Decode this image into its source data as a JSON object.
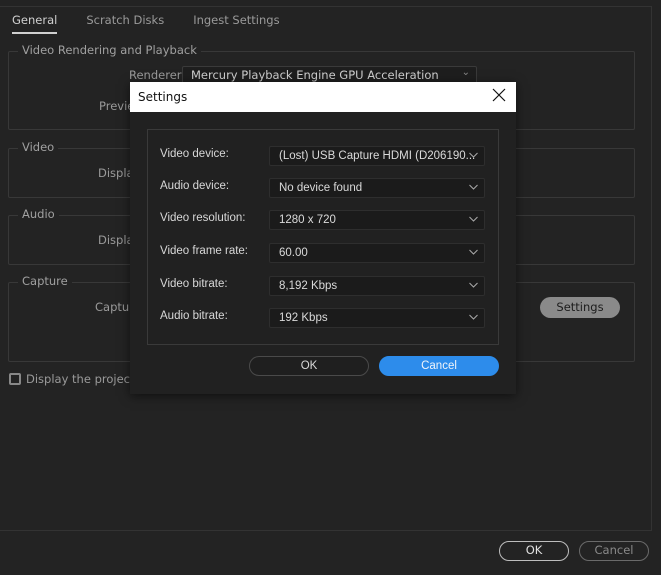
{
  "tabs": [
    {
      "label": "General",
      "active": true
    },
    {
      "label": "Scratch Disks",
      "active": false
    },
    {
      "label": "Ingest Settings",
      "active": false
    }
  ],
  "groups": {
    "video_rendering": {
      "title": "Video Rendering and Playback",
      "renderer_label": "Renderer:",
      "renderer_value": "Mercury Playback Engine GPU Acceleration (CUDA)",
      "preview_label": "Previe"
    },
    "video": {
      "title": "Video",
      "display_label": "Displa"
    },
    "audio": {
      "title": "Audio",
      "display_label": "Displa"
    },
    "capture": {
      "title": "Capture",
      "capture_label": "Capture",
      "settings_button": "Settings"
    }
  },
  "checkbox": {
    "label": "Display the project it",
    "checked": false
  },
  "footer": {
    "ok_label": "OK",
    "cancel_label": "Cancel"
  },
  "dialog": {
    "title": "Settings",
    "rows": [
      {
        "label": "Video device:",
        "value": "(Lost) USB Capture HDMI (D206190..."
      },
      {
        "label": "Audio device:",
        "value": "No device found"
      },
      {
        "label": "Video resolution:",
        "value": "1280 x 720"
      },
      {
        "label": "Video frame rate:",
        "value": "60.00"
      },
      {
        "label": "Video bitrate:",
        "value": "8,192 Kbps"
      },
      {
        "label": "Audio bitrate:",
        "value": "192 Kbps"
      }
    ],
    "ok_label": "OK",
    "cancel_label": "Cancel",
    "accent_color": "#2d8ceb"
  }
}
